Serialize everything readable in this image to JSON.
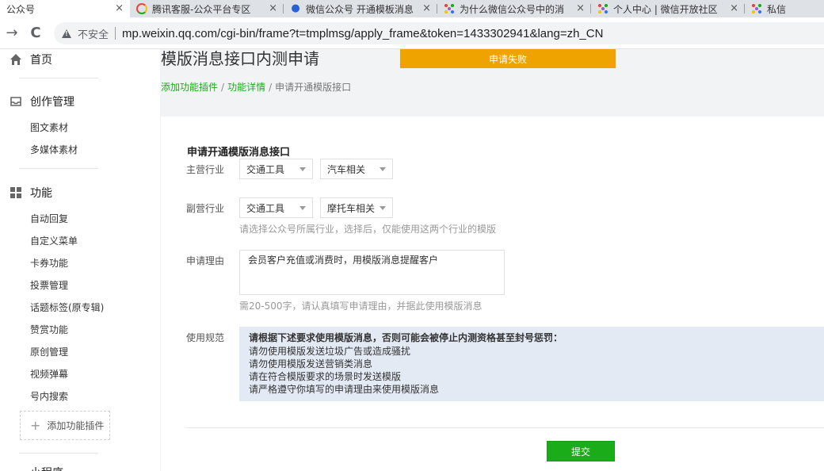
{
  "browser": {
    "tabs": [
      {
        "title": "公众号",
        "favicon": "none",
        "active": true
      },
      {
        "title": "腾讯客服-公众平台专区",
        "favicon": "qq-circle-icon",
        "active": false
      },
      {
        "title": "微信公众号 开通模板消息",
        "favicon": "paw-icon",
        "active": false
      },
      {
        "title": "为什么微信公众号中的消",
        "favicon": "colorful-dots-icon",
        "active": false
      },
      {
        "title": "个人中心 | 微信开放社区",
        "favicon": "colorful-dots-icon",
        "active": false
      },
      {
        "title": "私信",
        "favicon": "colorful-dots-icon",
        "active": false
      }
    ],
    "close_glyph": "×",
    "back_glyph": "→",
    "reload_glyph": "C",
    "insecure_label": "不安全",
    "url": "mp.weixin.qq.com/cgi-bin/frame?t=tmplmsg/apply_frame&token=1433302941&lang=zh_CN"
  },
  "sidebar": {
    "home": {
      "label": "首页",
      "icon": "home-icon"
    },
    "creation": {
      "label": "创作管理",
      "icon": "tray-icon",
      "items": [
        "图文素材",
        "多媒体素材"
      ]
    },
    "features": {
      "label": "功能",
      "icon": "grid-icon",
      "items": [
        "自动回复",
        "自定义菜单",
        "卡券功能",
        "投票管理",
        "话题标签(原专辑)",
        "赞赏功能",
        "原创管理",
        "视频弹幕",
        "号内搜索"
      ]
    },
    "add_plugin": {
      "plus": "+",
      "label": "添加功能插件"
    },
    "next_section_partial": "小程序"
  },
  "main": {
    "page_title": "模版消息接口内测申请",
    "status_banner": "申请失败",
    "breadcrumb": {
      "link1": "添加功能插件",
      "sep": "/",
      "link2": "功能详情",
      "current": "申请开通模版接口"
    },
    "form": {
      "section_title": "申请开通模版消息接口",
      "primary_industry": {
        "label": "主营行业",
        "select1": "交通工具",
        "select2": "汽车相关"
      },
      "secondary_industry": {
        "label": "副营行业",
        "select1": "交通工具",
        "select2": "摩托车相关"
      },
      "industry_hint": "请选择公众号所属行业，选择后，仅能使用这两个行业的模版",
      "reason": {
        "label": "申请理由",
        "value": "会员客户充值或消费时，用模版消息提醒客户",
        "hint": "需20-500字，请认真填写申请理由，并据此使用模版消息"
      },
      "rules": {
        "label": "使用规范",
        "title": "请根据下述要求使用模版消息，否则可能会被停止内测资格甚至封号惩罚：",
        "items": [
          "请勿使用模版发送垃圾广告或造成骚扰",
          "请勿使用模版发送营销类消息",
          "请在符合模版要求的场景时发送模版",
          "请严格遵守你填写的申请理由来使用模版消息"
        ]
      },
      "submit_label": "提交"
    }
  },
  "colors": {
    "brand_green": "#1aad19",
    "fail_orange": "#eea300",
    "rules_bg": "#e3eaf4"
  }
}
